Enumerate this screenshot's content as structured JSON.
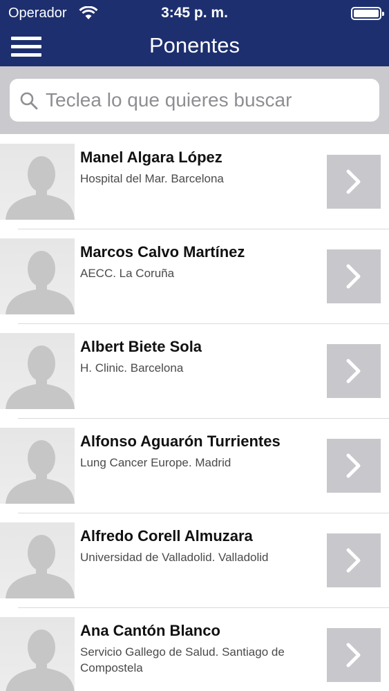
{
  "status_bar": {
    "carrier": "Operador",
    "time": "3:45 p. m."
  },
  "nav": {
    "title": "Ponentes",
    "menu_icon": "hamburger-menu-icon"
  },
  "search": {
    "placeholder": "Teclea lo que quieres buscar",
    "value": "",
    "icon": "search-icon"
  },
  "speakers": [
    {
      "name": "Manel Algara López",
      "affiliation": "Hospital del Mar. Barcelona"
    },
    {
      "name": "Marcos Calvo Martínez",
      "affiliation": "AECC. La Coruña"
    },
    {
      "name": "Albert Biete Sola",
      "affiliation": "H. Clinic. Barcelona"
    },
    {
      "name": "Alfonso Aguarón Turrientes",
      "affiliation": "Lung Cancer Europe. Madrid"
    },
    {
      "name": "Alfredo Corell Almuzara",
      "affiliation": "Universidad de Valladolid. Valladolid"
    },
    {
      "name": "Ana Cantón Blanco",
      "affiliation": "Servicio Gallego de Salud. Santiago de Compostela"
    }
  ],
  "colors": {
    "nav_background": "#1d2f6e",
    "search_band": "#c9c9ce",
    "detail_button": "#c7c7cc"
  }
}
